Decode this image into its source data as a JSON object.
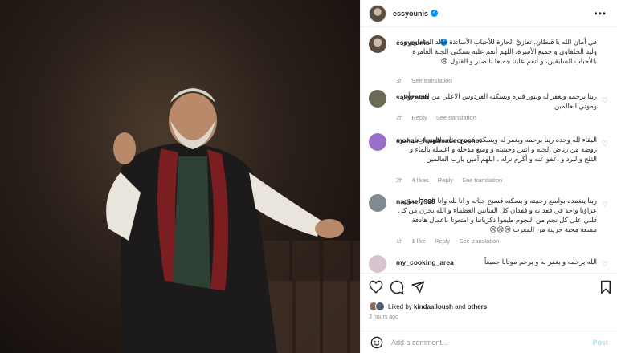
{
  "post": {
    "author": "essyounis",
    "caption": "في أمان الله يا قبطان، تعازيَّ الحارة للأحباب الأساتذة خالد الحلفاوي و وليد الحلفاوي و جميع الأسرة، اللهم أنعم عليه بسكني الجنة العامرة بالأحباب السابقين، و أنعم علينا جميعا بالصبر و القبول 😢",
    "caption_time": "3h",
    "see_translation": "See translation"
  },
  "comments": [
    {
      "user": "sallyzebib",
      "text": "ربنا يرحمه ويغفر له وينور قبره ويسكنه الفردوس الاعلي من الجنه وأبي وموتي العالمين",
      "time": "2h",
      "reply": "Reply",
      "translate": "See translation",
      "avatar_color": "#6b6a55"
    },
    {
      "user": "mohair_handmadecrochet",
      "text": "البقاء لله وحده ربنا يرحمه ويغفر له ويسكنه فسيح جناته اللهم اجعل قبره روضة من رياض الجنه و انس وحشته و وسع مدخله و اغسله بالماء و الثلج والبرد و أعفو عنه و أكرم نزله ، اللهم آمين يارب العالمين",
      "time": "2h",
      "likes": "4 likes",
      "reply": "Reply",
      "translate": "See translation",
      "avatar_color": "#9a6fc7"
    },
    {
      "user": "nadine.7998",
      "text": "ربنا يتغمده بواسع رحمته و يسكنه فسيح جناته و انا لله وانا اليه راجعون عزاؤنا واحد في فقدانه و فقدان كل الفنانين العظماء و الله بحزن من كل قلبي على كل نجم من النجوم طبعوا ذكرياتنا و امتعونا باعمال هادفة ممتعة محبة حزينة من المغرب 😢😢😢",
      "time": "1h",
      "likes": "1 like",
      "reply": "Reply",
      "translate": "See translation",
      "avatar_color": "#7e8b90"
    },
    {
      "user": "my_cooking_area",
      "text": "الله يرحمه و يغفر له و يرحم موتانا جميعاً",
      "avatar_color": "#d9c3cf"
    }
  ],
  "likes_line": {
    "prefix": "Liked by",
    "user": "kindaalloush",
    "and": "and",
    "others": "others"
  },
  "posted_ago": "3 hours ago",
  "add_comment": {
    "placeholder": "Add a comment...",
    "post_label": "Post"
  },
  "icons": [
    "heart-icon",
    "comment-icon",
    "share-icon",
    "save-icon",
    "emoji-icon",
    "more-icon",
    "verified-icon"
  ],
  "colors": {
    "verified": "#0095f6",
    "muted": "#8e8e8e",
    "post_btn": "#b2dffc"
  }
}
